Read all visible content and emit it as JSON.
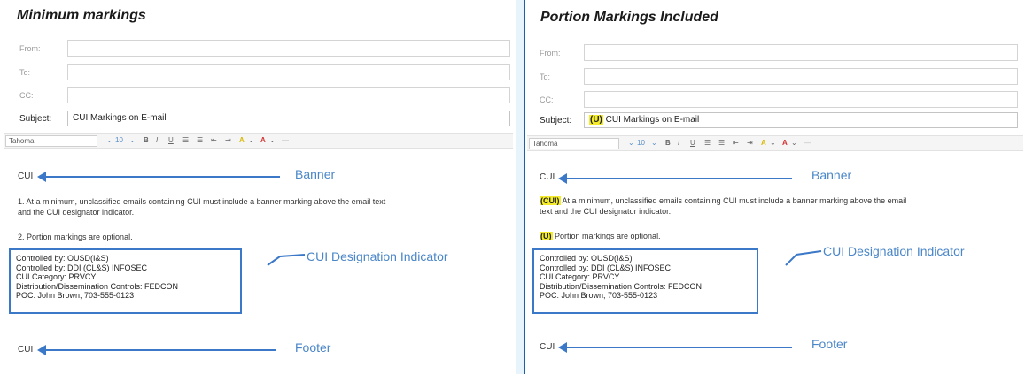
{
  "left": {
    "title": "Minimum markings",
    "fields": {
      "from": "From:",
      "to": "To:",
      "cc": "CC:",
      "subject_label": "Subject:"
    },
    "subject_value": "CUI Markings on E-mail",
    "toolbar": {
      "font": "Tahoma",
      "buttons": [
        "⌄",
        "10",
        "⌄",
        "B",
        "I",
        "U",
        "☰",
        "☰",
        "⇤",
        "⇥",
        "A",
        "⌄",
        "A",
        "⌄",
        "—"
      ]
    },
    "banner_text": "CUI",
    "banner_label": "Banner",
    "para1_line1": "1.  At a minimum, unclassified emails containing CUI must include a banner marking above the  email text",
    "para1_line2": "and the CUI designator indicator.",
    "para2": "2. Portion markings are optional.",
    "indicator_lines": [
      "Controlled by: OUSD(I&S)",
      "Controlled by: DDI (CL&S) INFOSEC",
      "CUI Category:  PRVCY",
      "Distribution/Dissemination Controls:  FEDCON",
      "POC:  John Brown, 703-555-0123"
    ],
    "indicator_label": "CUI Designation Indicator",
    "footer_text": "CUI",
    "footer_label": "Footer"
  },
  "right": {
    "title": "Portion Markings Included",
    "fields": {
      "from": "From:",
      "to": "To:",
      "cc": "CC:",
      "subject_label": "Subject:"
    },
    "subject_portion": "(U)",
    "subject_value": " CUI Markings on E-mail",
    "toolbar": {
      "font": "Tahoma",
      "buttons": [
        "⌄",
        "10",
        "⌄",
        "B",
        "I",
        "U",
        "☰",
        "☰",
        "⇤",
        "⇥",
        "A",
        "⌄",
        "A",
        "⌄",
        "—"
      ]
    },
    "banner_text": "CUI",
    "banner_label": "Banner",
    "para1_portion": "(CUI)",
    "para1_line1": " At a minimum, unclassified emails containing CUI must include a banner marking above the  email",
    "para1_line2": "text and the CUI designator indicator.",
    "para2_portion": "(U)",
    "para2": " Portion markings are optional.",
    "indicator_lines": [
      "Controlled by: OUSD(I&S)",
      "Controlled by: DDI (CL&S) INFOSEC",
      "CUI Category:  PRVCY",
      "Distribution/Dissemination Controls:  FEDCON",
      "POC:  John Brown, 703-555-0123"
    ],
    "indicator_label": "CUI Designation Indicator",
    "footer_text": "CUI",
    "footer_label": "Footer"
  }
}
